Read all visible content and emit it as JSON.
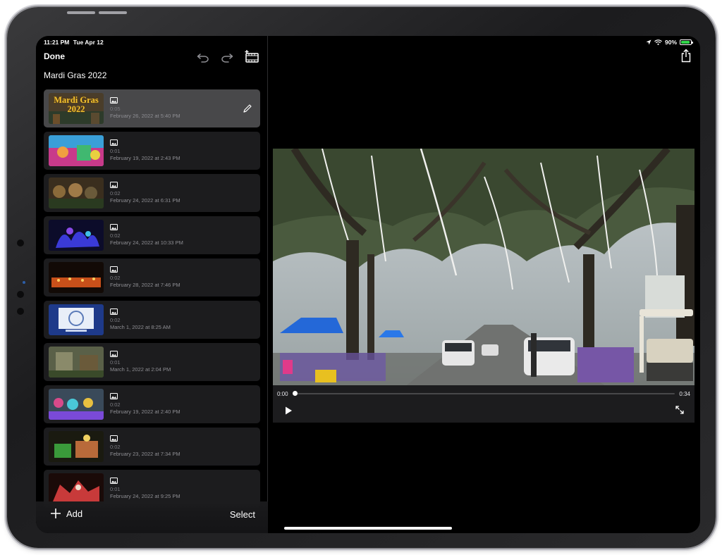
{
  "status_bar": {
    "time": "11:21 PM",
    "date": "Tue Apr 12",
    "battery": "90%",
    "battery_level": 0.9
  },
  "toolbar": {
    "done_label": "Done",
    "icons": [
      "undo-icon",
      "redo-icon",
      "add-clip-icon",
      "share-icon"
    ]
  },
  "project": {
    "title": "Mardi Gras 2022"
  },
  "clips": [
    {
      "duration": "0:05",
      "date": "February 26, 2022 at 5:40 PM",
      "selected": true,
      "thumb_text": "Mardi Gras 2022"
    },
    {
      "duration": "0:01",
      "date": "February 19, 2022 at 2:43 PM"
    },
    {
      "duration": "0:02",
      "date": "February 24, 2022 at 6:31 PM"
    },
    {
      "duration": "0:02",
      "date": "February 24, 2022 at 10:33 PM"
    },
    {
      "duration": "0:02",
      "date": "February 28, 2022 at 7:46 PM"
    },
    {
      "duration": "0:02",
      "date": "March 1, 2022 at 8:25 AM"
    },
    {
      "duration": "0:01",
      "date": "March 1, 2022 at 2:04 PM"
    },
    {
      "duration": "0:02",
      "date": "February 19, 2022 at 2:40 PM"
    },
    {
      "duration": "0:02",
      "date": "February 23, 2022 at 7:34 PM"
    },
    {
      "duration": "0:01",
      "date": "February 24, 2022 at 9:25 PM"
    }
  ],
  "footer": {
    "add_label": "Add",
    "select_label": "Select"
  },
  "player": {
    "current_time": "0:00",
    "total_time": "0:34",
    "progress": 0.0
  },
  "colors": {
    "selected_row": "#48484a",
    "row": "#1c1c1e",
    "battery_green": "#32d74b"
  }
}
